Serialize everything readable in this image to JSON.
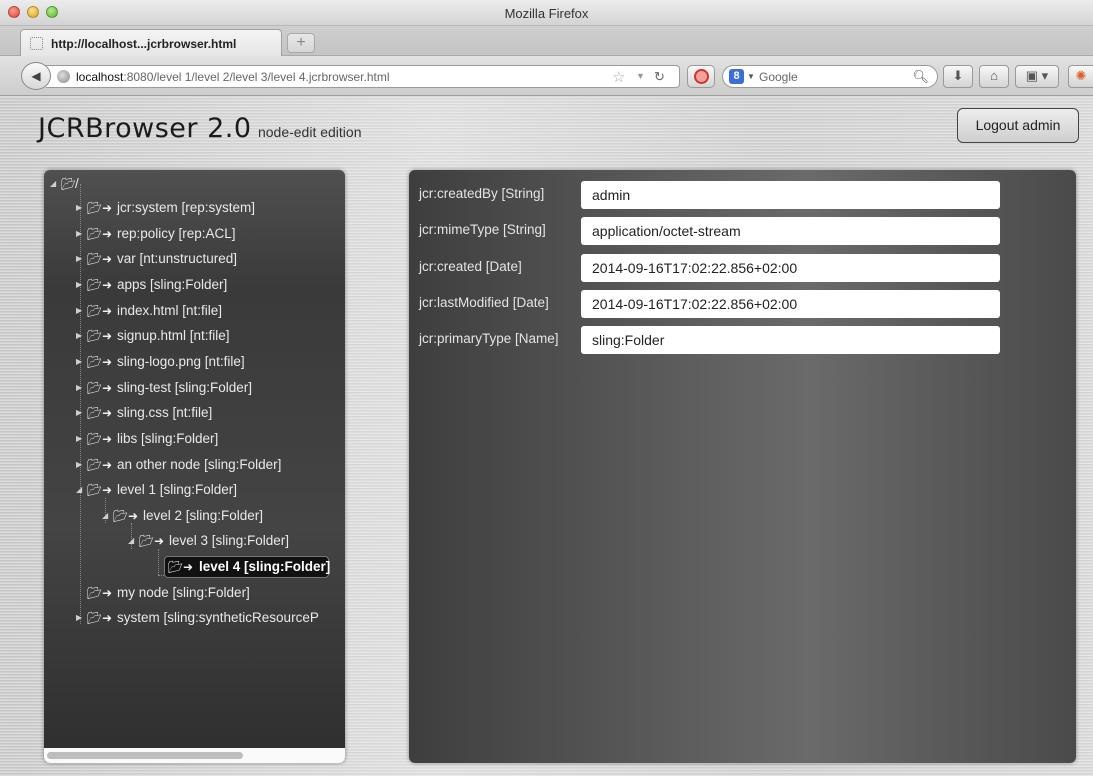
{
  "window": {
    "title": "Mozilla Firefox"
  },
  "tabs": [
    {
      "label": "http://localhost...jcrbrowser.html"
    }
  ],
  "newtab_label": "+",
  "urlbar": {
    "host": "localhost",
    "path": ":8080/level 1/level 2/level 3/level 4.jcrbrowser.html"
  },
  "search": {
    "placeholder": "Google",
    "engine_letter": "8"
  },
  "page": {
    "brand_title": "JCRBrowser 2.0",
    "brand_subtitle": "node-edit edition",
    "logout_label": "Logout admin"
  },
  "tree": {
    "root_label": "/",
    "nodes": [
      {
        "label": "jcr:system [rep:system]"
      },
      {
        "label": "rep:policy [rep:ACL]"
      },
      {
        "label": "var [nt:unstructured]"
      },
      {
        "label": "apps [sling:Folder]"
      },
      {
        "label": "index.html [nt:file]"
      },
      {
        "label": "signup.html [nt:file]"
      },
      {
        "label": "sling-logo.png [nt:file]"
      },
      {
        "label": "sling-test [sling:Folder]"
      },
      {
        "label": "sling.css [nt:file]"
      },
      {
        "label": "libs [sling:Folder]"
      },
      {
        "label": "an other node [sling:Folder]"
      },
      {
        "label": "level 1 [sling:Folder]"
      },
      {
        "label": "level 2 [sling:Folder]"
      },
      {
        "label": "level 3 [sling:Folder]"
      },
      {
        "label": "level 4 [sling:Folder]"
      },
      {
        "label": "my node [sling:Folder]"
      },
      {
        "label": "system [sling:syntheticResourceP"
      }
    ]
  },
  "properties": [
    {
      "name": "jcr:createdBy [String]",
      "value": "admin"
    },
    {
      "name": "jcr:mimeType [String]",
      "value": "application/octet-stream"
    },
    {
      "name": "jcr:created [Date]",
      "value": "2014-09-16T17:02:22.856+02:00"
    },
    {
      "name": "jcr:lastModified [Date]",
      "value": "2014-09-16T17:02:22.856+02:00"
    },
    {
      "name": "jcr:primaryType [Name]",
      "value": "sling:Folder"
    }
  ]
}
